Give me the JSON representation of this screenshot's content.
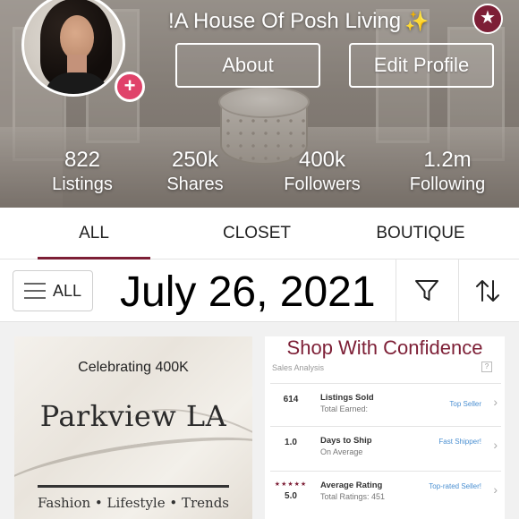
{
  "profile": {
    "closet_name": "!A House Of Posh Living",
    "sparkle": "✨",
    "plus_glyph": "+",
    "star_glyph": "★",
    "about_label": "About",
    "edit_profile_label": "Edit Profile"
  },
  "stats": [
    {
      "value": "822",
      "label": "Listings"
    },
    {
      "value": "250k",
      "label": "Shares"
    },
    {
      "value": "400k",
      "label": "Followers"
    },
    {
      "value": "1.2m",
      "label": "Following"
    }
  ],
  "tabs": [
    {
      "label": "ALL",
      "active": true
    },
    {
      "label": "CLOSET",
      "active": false
    },
    {
      "label": "BOUTIQUE",
      "active": false
    }
  ],
  "filter": {
    "all_label": "ALL",
    "date_overlay": "July 26, 2021"
  },
  "listing_left": {
    "celebrating": "Celebrating 400K",
    "brand": "Parkview LA",
    "tagline": "Fashion • Lifestyle • Trends"
  },
  "listing_right": {
    "title": "Shop With Confidence",
    "section_label": "Sales Analysis",
    "help_glyph": "?",
    "rows": [
      {
        "value": "614",
        "stars": "",
        "title": "Listings Sold",
        "subtitle": "Total Earned:",
        "badge": "Top Seller"
      },
      {
        "value": "1.0",
        "stars": "",
        "title": "Days to Ship",
        "subtitle": "On Average",
        "badge": "Fast Shipper!"
      },
      {
        "value": "5.0",
        "stars": "★★★★★",
        "title": "Average Rating",
        "subtitle": "Total Ratings: 451",
        "badge": "Top-rated Seller!"
      }
    ]
  },
  "colors": {
    "accent": "#7d1f36",
    "plus_badge": "#e0426a",
    "link_blue": "#4a8fd1"
  },
  "icons": {
    "filter": "funnel-icon",
    "sort": "sort-arrows-icon",
    "menu": "hamburger-icon"
  }
}
